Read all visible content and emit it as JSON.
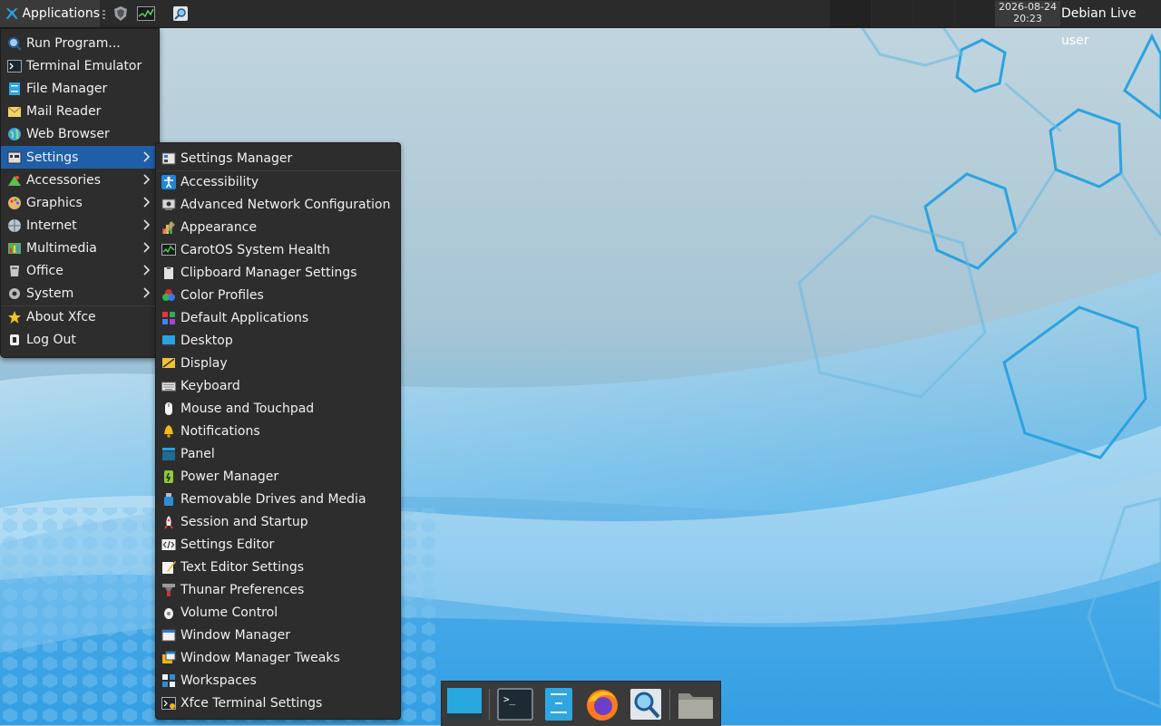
{
  "panel": {
    "apps_label": "Applications",
    "clock_date": "2026-08-24",
    "clock_time": "20:23",
    "user": "Debian Live user",
    "launcher_icons": [
      "list-icon",
      "shield-icon",
      "system-monitor-icon",
      "search-icon"
    ]
  },
  "apps_menu": {
    "items": [
      {
        "label": "Run Program...",
        "icon": "run-program-icon"
      },
      {
        "label": "Terminal Emulator",
        "icon": "terminal-icon"
      },
      {
        "label": "File Manager",
        "icon": "file-manager-icon"
      },
      {
        "label": "Mail Reader",
        "icon": "mail-icon"
      },
      {
        "label": "Web Browser",
        "icon": "globe-icon"
      },
      {
        "label": "Settings",
        "icon": "settings-icon",
        "submenu": true,
        "active": true
      },
      {
        "label": "Accessories",
        "icon": "accessories-icon",
        "submenu": true
      },
      {
        "label": "Graphics",
        "icon": "palette-icon",
        "submenu": true
      },
      {
        "label": "Internet",
        "icon": "internet-icon",
        "submenu": true
      },
      {
        "label": "Multimedia",
        "icon": "multimedia-icon",
        "submenu": true
      },
      {
        "label": "Office",
        "icon": "office-icon",
        "submenu": true
      },
      {
        "label": "System",
        "icon": "gear-icon",
        "submenu": true
      },
      {
        "label": "About Xfce",
        "icon": "star-icon"
      },
      {
        "label": "Log Out",
        "icon": "logout-icon"
      }
    ]
  },
  "settings_menu": {
    "items": [
      {
        "label": "Settings Manager",
        "icon": "settings-manager-icon"
      },
      {
        "label": "Accessibility",
        "icon": "accessibility-icon"
      },
      {
        "label": "Advanced Network Configuration",
        "icon": "network-icon"
      },
      {
        "label": "Appearance",
        "icon": "appearance-icon"
      },
      {
        "label": "CarotOS System Health",
        "icon": "system-health-icon"
      },
      {
        "label": "Clipboard Manager Settings",
        "icon": "clipboard-icon"
      },
      {
        "label": "Color Profiles",
        "icon": "color-profiles-icon"
      },
      {
        "label": "Default Applications",
        "icon": "default-apps-icon"
      },
      {
        "label": "Desktop",
        "icon": "desktop-icon"
      },
      {
        "label": "Display",
        "icon": "display-icon"
      },
      {
        "label": "Keyboard",
        "icon": "keyboard-icon"
      },
      {
        "label": "Mouse and Touchpad",
        "icon": "mouse-icon"
      },
      {
        "label": "Notifications",
        "icon": "bell-icon"
      },
      {
        "label": "Panel",
        "icon": "panel-icon"
      },
      {
        "label": "Power Manager",
        "icon": "battery-icon"
      },
      {
        "label": "Removable Drives and Media",
        "icon": "usb-drive-icon"
      },
      {
        "label": "Session and Startup",
        "icon": "rocket-icon"
      },
      {
        "label": "Settings Editor",
        "icon": "code-icon"
      },
      {
        "label": "Text Editor Settings",
        "icon": "text-editor-icon"
      },
      {
        "label": "Thunar Preferences",
        "icon": "thunar-icon"
      },
      {
        "label": "Volume Control",
        "icon": "volume-icon"
      },
      {
        "label": "Window Manager",
        "icon": "window-manager-icon"
      },
      {
        "label": "Window Manager Tweaks",
        "icon": "window-tweaks-icon"
      },
      {
        "label": "Workspaces",
        "icon": "workspaces-icon"
      },
      {
        "label": "Xfce Terminal Settings",
        "icon": "terminal-settings-icon"
      }
    ]
  },
  "dock": {
    "items": [
      "show-desktop-icon",
      "terminal-icon",
      "file-manager-icon",
      "firefox-icon",
      "app-finder-icon",
      "folder-icon"
    ]
  },
  "colors": {
    "panel_bg": "#2b2b2b",
    "menu_bg": "#2d2d2d",
    "highlight": "#1f5fa8",
    "accent_blue": "#1ea0dc"
  }
}
